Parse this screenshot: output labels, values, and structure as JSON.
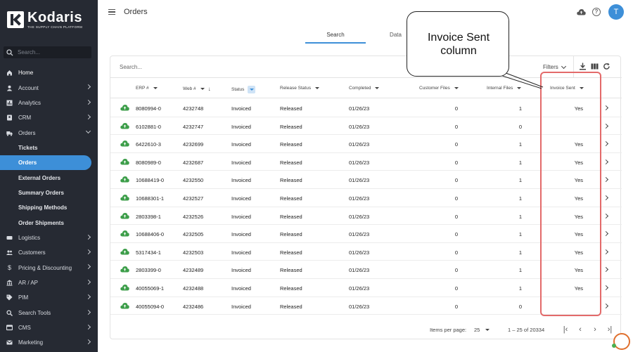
{
  "brand": {
    "name": "Kodaris",
    "tagline": "THE SUPPLY CHAIN PLATFORM"
  },
  "sidebar": {
    "search_placeholder": "Search...",
    "items": [
      {
        "label": "Home",
        "icon": "home-icon",
        "expandable": false
      },
      {
        "label": "Account",
        "icon": "account-icon",
        "expandable": true
      },
      {
        "label": "Analytics",
        "icon": "analytics-icon",
        "expandable": true
      },
      {
        "label": "CRM",
        "icon": "crm-icon",
        "expandable": true
      },
      {
        "label": "Orders",
        "icon": "orders-truck-icon",
        "expandable": true,
        "expanded": true
      }
    ],
    "subitems": [
      {
        "label": "Tickets"
      },
      {
        "label": "Orders",
        "active": true
      },
      {
        "label": "External Orders"
      },
      {
        "label": "Summary Orders"
      },
      {
        "label": "Shipping Methods"
      },
      {
        "label": "Order Shipments"
      }
    ],
    "items_after": [
      {
        "label": "Logistics",
        "icon": "logistics-icon"
      },
      {
        "label": "Customers",
        "icon": "customers-icon"
      },
      {
        "label": "Pricing & Discounting",
        "icon": "dollar-icon"
      },
      {
        "label": "AR / AP",
        "icon": "bank-icon"
      },
      {
        "label": "PIM",
        "icon": "tag-icon"
      },
      {
        "label": "Search Tools",
        "icon": "search-icon"
      },
      {
        "label": "CMS",
        "icon": "cms-icon"
      },
      {
        "label": "Marketing",
        "icon": "marketing-icon"
      }
    ]
  },
  "header": {
    "title": "Orders",
    "avatar_initial": "T",
    "help": "?"
  },
  "tabs": [
    {
      "label": "Search",
      "active": true
    },
    {
      "label": "Data",
      "active": false
    }
  ],
  "toolbar": {
    "search_placeholder": "Search...",
    "filters_label": "Filters"
  },
  "table": {
    "columns": {
      "erp": "ERP #",
      "web": "Web #",
      "status": "Status",
      "release": "Release Status",
      "completed": "Completed",
      "customer_files": "Customer Files",
      "internal_files": "Internal Files",
      "invoice_sent": "Invoice Sent"
    },
    "rows": [
      {
        "erp": "8080994-0",
        "web": "4232748",
        "status": "Invoiced",
        "release": "Released",
        "completed": "01/26/23",
        "customer_files": "0",
        "internal_files": "1",
        "invoice_sent": "Yes"
      },
      {
        "erp": "6102881-0",
        "web": "4232747",
        "status": "Invoiced",
        "release": "Released",
        "completed": "01/26/23",
        "customer_files": "0",
        "internal_files": "0",
        "invoice_sent": ""
      },
      {
        "erp": "6422610-3",
        "web": "4232699",
        "status": "Invoiced",
        "release": "Released",
        "completed": "01/26/23",
        "customer_files": "0",
        "internal_files": "1",
        "invoice_sent": "Yes"
      },
      {
        "erp": "8080989-0",
        "web": "4232687",
        "status": "Invoiced",
        "release": "Released",
        "completed": "01/26/23",
        "customer_files": "0",
        "internal_files": "1",
        "invoice_sent": "Yes"
      },
      {
        "erp": "10688419-0",
        "web": "4232550",
        "status": "Invoiced",
        "release": "Released",
        "completed": "01/26/23",
        "customer_files": "0",
        "internal_files": "1",
        "invoice_sent": "Yes"
      },
      {
        "erp": "10688301-1",
        "web": "4232527",
        "status": "Invoiced",
        "release": "Released",
        "completed": "01/26/23",
        "customer_files": "0",
        "internal_files": "1",
        "invoice_sent": "Yes"
      },
      {
        "erp": "2803398-1",
        "web": "4232526",
        "status": "Invoiced",
        "release": "Released",
        "completed": "01/26/23",
        "customer_files": "0",
        "internal_files": "1",
        "invoice_sent": "Yes"
      },
      {
        "erp": "10688406-0",
        "web": "4232505",
        "status": "Invoiced",
        "release": "Released",
        "completed": "01/26/23",
        "customer_files": "0",
        "internal_files": "1",
        "invoice_sent": "Yes"
      },
      {
        "erp": "5317434-1",
        "web": "4232503",
        "status": "Invoiced",
        "release": "Released",
        "completed": "01/26/23",
        "customer_files": "0",
        "internal_files": "1",
        "invoice_sent": "Yes"
      },
      {
        "erp": "2803399-0",
        "web": "4232489",
        "status": "Invoiced",
        "release": "Released",
        "completed": "01/26/23",
        "customer_files": "0",
        "internal_files": "1",
        "invoice_sent": "Yes"
      },
      {
        "erp": "40055069-1",
        "web": "4232488",
        "status": "Invoiced",
        "release": "Released",
        "completed": "01/26/23",
        "customer_files": "0",
        "internal_files": "1",
        "invoice_sent": "Yes"
      },
      {
        "erp": "40055094-0",
        "web": "4232486",
        "status": "Invoiced",
        "release": "Released",
        "completed": "01/26/23",
        "customer_files": "0",
        "internal_files": "0",
        "invoice_sent": ""
      }
    ]
  },
  "pagination": {
    "items_per_page_label": "Items per page:",
    "items_per_page": "25",
    "range": "1 – 25 of 20334"
  },
  "annotation": {
    "line1": "Invoice Sent",
    "line2": "column",
    "highlight_color": "#e36a6a"
  },
  "colors": {
    "sidebar_bg": "#262a33",
    "accent": "#3d8fd8",
    "upload_icon": "#3d9e4a"
  }
}
